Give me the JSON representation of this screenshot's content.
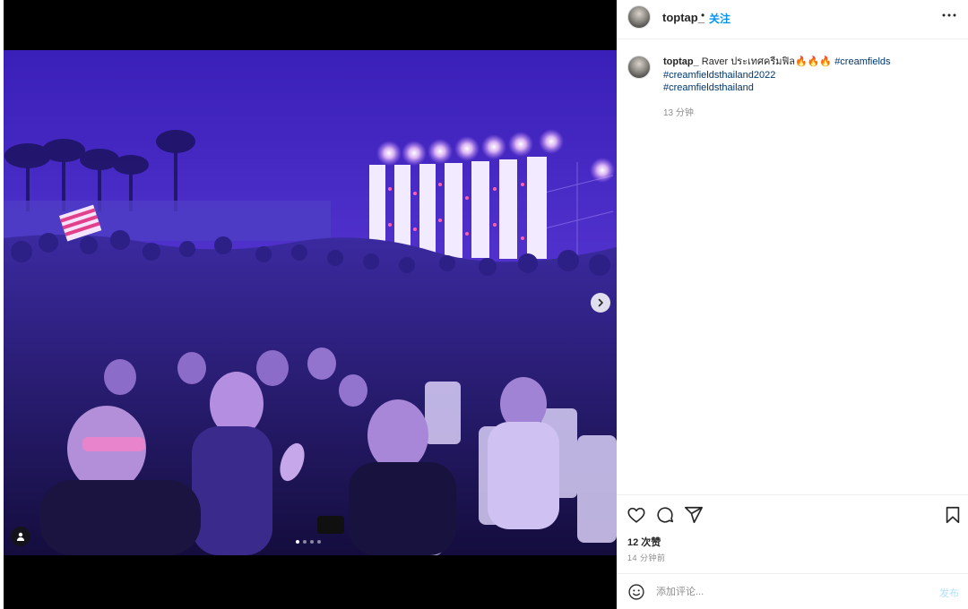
{
  "post": {
    "username": "toptap_",
    "separator": "•",
    "follow_label": "关注",
    "caption": {
      "username": "toptap_",
      "text": "Raver ประเทศครีมฟิล🔥🔥🔥",
      "hashtags": [
        "#creamfields",
        "#creamfieldsthailand2022",
        "#creamfieldsthailand"
      ],
      "time": "13 分钟"
    },
    "likes": "12 次赞",
    "time": "14 分钟前",
    "carousel": {
      "count": 4,
      "active_index": 0
    }
  },
  "comment": {
    "placeholder": "添加评论...",
    "value": "",
    "publish_label": "发布"
  },
  "icons": {
    "more": "more-horizontal-icon",
    "like": "heart-icon",
    "comment": "comment-icon",
    "share": "send-icon",
    "save": "bookmark-icon",
    "emoji": "emoji-icon",
    "next": "chevron-right-icon",
    "tag": "user-tag-icon"
  },
  "colors": {
    "accent": "#0095f6",
    "hashtag": "#00376b",
    "secondary_text": "#8e8e8e",
    "publish_disabled": "#b2dffc"
  }
}
